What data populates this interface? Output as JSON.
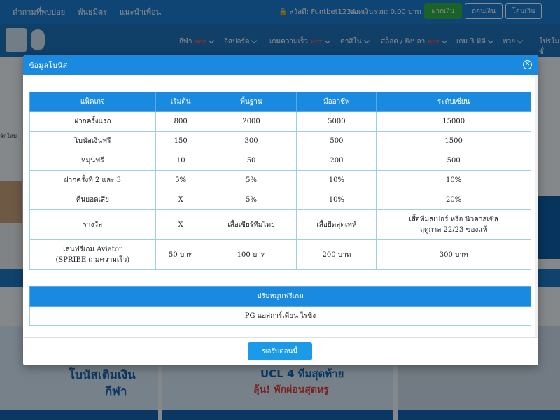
{
  "topbar": {
    "links": [
      "คำถามที่พบบ่อย",
      "พันธมิตร",
      "แนะนำเพื่อน"
    ],
    "greeting": "สวัสดี: Funtbet1234",
    "balance_label": "ยอดเงินรวม: 0.00 บาท",
    "deposit_label": "ฝากเงิน",
    "withdraw_label": "ถอนเงิน",
    "transfer_label": "โอนเงิน"
  },
  "navbar": {
    "items": [
      {
        "label": "กีฬา",
        "badge": "HOT"
      },
      {
        "label": "อีสปอร์ต",
        "badge": ""
      },
      {
        "label": "เกมความเร็ว",
        "badge": "HOT"
      },
      {
        "label": "คาสิโน",
        "badge": ""
      },
      {
        "label": "สล็อต / ยิงปลา",
        "badge": "HOT"
      },
      {
        "label": "เกม 3 มิติ",
        "badge": ""
      },
      {
        "label": "หวย",
        "badge": ""
      },
      {
        "label": "โปรโมชั่",
        "badge": ""
      }
    ]
  },
  "background": {
    "left_text": "สิกใหม่",
    "promo_titles": [
      "โบนัสเติมเงิน",
      "กีฬา",
      "UCL 4 ทีมสุดท้าย",
      "ลุ้น! พักผ่อนสุดหรู"
    ]
  },
  "modal": {
    "title": "ข้อมูลโบนัส",
    "table": {
      "headers": [
        "แพ็คเกจ",
        "เริ่มต้น",
        "พื้นฐาน",
        "มืออาชีพ",
        "ระดับเซียน"
      ],
      "rows": [
        [
          "ฝากครั้งแรก",
          "800",
          "2000",
          "5000",
          "15000"
        ],
        [
          "โบนัสเงินฟรี",
          "150",
          "300",
          "500",
          "1500"
        ],
        [
          "หมุนฟรี",
          "10",
          "50",
          "200",
          "500"
        ],
        [
          "ฝากครั้งที่ 2 และ 3",
          "5%",
          "5%",
          "10%",
          "10%"
        ],
        [
          "คืนยอดเสีย",
          "X",
          "5%",
          "10%",
          "20%"
        ]
      ],
      "reward_row": {
        "label": "รางวัล",
        "starter": "X",
        "basic": "เสื้อเชียร์ทีมไทย",
        "pro": "เสื้อยืดสุดเท่ห์",
        "expert_line1": "เสื้อทีมสเปอร์ หรือ นิวคาสเซิ่ล",
        "expert_line2": "ฤดูกาล 22/23 ของแท้"
      },
      "aviator_row": {
        "label_line1": "เล่นฟรีเกม Aviator",
        "label_line2": "(SPRIBE เกมความเร็ว)",
        "starter": "50 บาท",
        "basic": "100 บาท",
        "pro": "200 บาท",
        "expert": "300 บาท"
      }
    },
    "spin": {
      "header": "ปรับหมุนฟรีเกม",
      "value": "PG แอสการ์เดียน ไรซิ่ง"
    },
    "claim_label": "ขอรับตอนนี้"
  },
  "colors": {
    "primary": "#1a8ae0",
    "topbar": "#1a7fd4",
    "deposit_green": "#33b14a",
    "hot_red": "#ff4d4d"
  }
}
